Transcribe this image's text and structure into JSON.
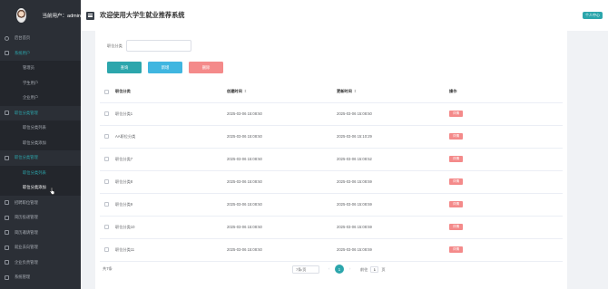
{
  "sidebar": {
    "user_label": "当前用户：admin",
    "items": [
      {
        "label": "后台首页",
        "type": "top",
        "icon": "home-icon"
      },
      {
        "label": "系统用户",
        "type": "top",
        "icon": "user-icon",
        "state": "open"
      },
      {
        "label": "管理员",
        "type": "sub"
      },
      {
        "label": "学生用户",
        "type": "sub"
      },
      {
        "label": "企业用户",
        "type": "sub"
      },
      {
        "label": "职位分类管理",
        "type": "top",
        "icon": "folder-icon",
        "state": "open"
      },
      {
        "label": "职位分类列表",
        "type": "sub"
      },
      {
        "label": "职位分类添加",
        "type": "sub"
      },
      {
        "label": "职位分类管理",
        "type": "top",
        "icon": "folder-icon",
        "state": "open"
      },
      {
        "label": "职位分类列表",
        "type": "sub",
        "state": "active"
      },
      {
        "label": "职位分类添加",
        "type": "sub",
        "state": "hover"
      },
      {
        "label": "招聘职位管理",
        "type": "top",
        "icon": "folder-icon"
      },
      {
        "label": "简历投递管理",
        "type": "top",
        "icon": "folder-icon"
      },
      {
        "label": "简历邀请管理",
        "type": "top",
        "icon": "folder-icon"
      },
      {
        "label": "就业去向管理",
        "type": "top",
        "icon": "folder-icon"
      },
      {
        "label": "企业负责管理",
        "type": "top",
        "icon": "folder-icon"
      },
      {
        "label": "系统管理",
        "type": "top",
        "icon": "folder-icon"
      }
    ]
  },
  "header": {
    "title": "欢迎使用大学生就业推荐系统",
    "user_center": "个人中心"
  },
  "search": {
    "label": "职位分类",
    "value": ""
  },
  "buttons": {
    "search": "查询",
    "add": "新增",
    "delete": "删除"
  },
  "table": {
    "headers": {
      "name": "职位分类",
      "created": "创建时间",
      "updated": "更新时间",
      "actions": "操作"
    },
    "sort_icon": "⇕",
    "rows": [
      {
        "name": "职位分类1",
        "created": "2025-03-06 15:08:50",
        "updated": "2025-03-06 15:08:50",
        "action": "详情"
      },
      {
        "name": "AA职位分类",
        "created": "2025-03-06 15:08:50",
        "updated": "2025-03-06 15:10:29",
        "action": "详情"
      },
      {
        "name": "职位分类7",
        "created": "2025-03-06 15:08:50",
        "updated": "2025-03-06 15:08:52",
        "action": "详情"
      },
      {
        "name": "职位分类8",
        "created": "2025-03-06 15:08:50",
        "updated": "2025-03-06 15:08:59",
        "action": "详情"
      },
      {
        "name": "职位分类9",
        "created": "2025-03-06 15:08:50",
        "updated": "2025-03-06 15:08:59",
        "action": "详情"
      },
      {
        "name": "职位分类10",
        "created": "2025-03-06 15:08:50",
        "updated": "2025-03-06 15:08:59",
        "action": "详情"
      },
      {
        "name": "职位分类11",
        "created": "2025-03-06 15:08:50",
        "updated": "2025-03-06 15:08:59",
        "action": "详情"
      }
    ]
  },
  "pagination": {
    "total": "共7条",
    "page_size": "7条/页",
    "prev": "‹",
    "current": "1",
    "next": "›",
    "goto_label": "前往",
    "goto_value": "1",
    "goto_suffix": "页"
  },
  "colors": {
    "accent": "#2ca6ac",
    "danger": "#f48a8a",
    "add": "#40b6e0",
    "sidebar_bg": "#2b2f36"
  }
}
